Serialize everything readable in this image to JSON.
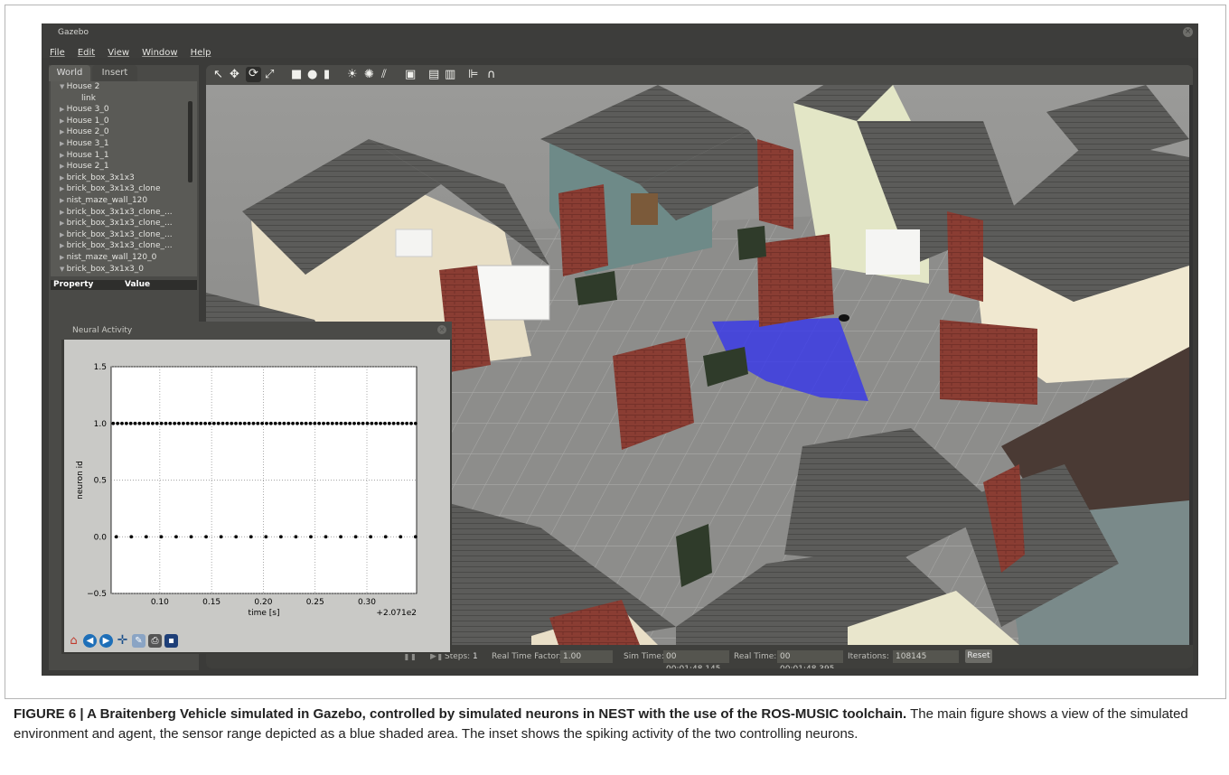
{
  "window": {
    "title": "Gazebo",
    "close_icon": "close-icon"
  },
  "menu": [
    "File",
    "Edit",
    "View",
    "Window",
    "Help"
  ],
  "left_panel": {
    "tabs": [
      "World",
      "Insert"
    ],
    "tree": [
      {
        "label": "House 2",
        "expanded": true
      },
      {
        "label": "link",
        "child": true
      },
      {
        "label": "House 3_0"
      },
      {
        "label": "House 1_0"
      },
      {
        "label": "House 2_0"
      },
      {
        "label": "House 3_1"
      },
      {
        "label": "House 1_1"
      },
      {
        "label": "House 2_1"
      },
      {
        "label": "brick_box_3x1x3"
      },
      {
        "label": "brick_box_3x1x3_clone"
      },
      {
        "label": "nist_maze_wall_120"
      },
      {
        "label": "brick_box_3x1x3_clone_..."
      },
      {
        "label": "brick_box_3x1x3_clone_..."
      },
      {
        "label": "brick_box_3x1x3_clone_..."
      },
      {
        "label": "brick_box_3x1x3_clone_..."
      },
      {
        "label": "nist_maze_wall_120_0"
      },
      {
        "label": "brick_box_3x1x3_0",
        "expanded": true
      }
    ],
    "property_header": {
      "property": "Property",
      "value": "Value"
    }
  },
  "toolbar_icons": [
    "select-arrow-icon",
    "translate-icon",
    "rotate-icon",
    "scale-icon",
    "box-icon",
    "sphere-icon",
    "cylinder-icon",
    "point-light-icon",
    "spot-light-icon",
    "directional-light-icon",
    "screenshot-icon",
    "copy-icon",
    "paste-icon",
    "align-icon",
    "snap-icon"
  ],
  "bottom_bar": {
    "steps_label": "Steps:",
    "steps_value": "1",
    "rtf_label": "Real Time Factor:",
    "rtf_value": "1.00",
    "sim_time_label": "Sim Time:",
    "sim_time_value": "00 00:01:48.145",
    "real_time_label": "Real Time:",
    "real_time_value": "00 00:01:48.395",
    "iterations_label": "Iterations:",
    "iterations_value": "108145",
    "reset_label": "Reset"
  },
  "neural_window": {
    "title": "Neural Activity",
    "toolbar_icons": [
      "home-icon",
      "back-icon",
      "forward-icon",
      "pan-icon",
      "configure-icon",
      "print-icon",
      "save-icon"
    ]
  },
  "chart_data": {
    "type": "scatter",
    "xlabel": "time [s]",
    "ylabel": "neuron id",
    "offset_label": "+2.071e2",
    "xlim": [
      0.053,
      0.348
    ],
    "ylim": [
      -0.5,
      1.5
    ],
    "xticks": [
      "0.10",
      "0.15",
      "0.20",
      "0.25",
      "0.30"
    ],
    "xtick_values": [
      0.1,
      0.15,
      0.2,
      0.25,
      0.3
    ],
    "yticks": [
      "−0.5",
      "0.0",
      "0.5",
      "1.0",
      "1.5"
    ],
    "ytick_values": [
      -0.5,
      0.0,
      0.5,
      1.0,
      1.5
    ],
    "grid": true,
    "series": [
      {
        "y": 1.0,
        "x_start": 0.055,
        "x_end": 0.347,
        "count": 70
      },
      {
        "y": 0.0,
        "x_start": 0.058,
        "x_end": 0.347,
        "count": 21
      }
    ]
  },
  "caption": {
    "bold": "FIGURE 6 | A Braitenberg Vehicle simulated in Gazebo, controlled by simulated neurons in NEST with the use of the ROS-MUSIC toolchain.",
    "text": " The main figure shows a view of the simulated environment and agent, the sensor range depicted as a blue shaded area. The inset shows the spiking activity of the two controlling neurons."
  }
}
